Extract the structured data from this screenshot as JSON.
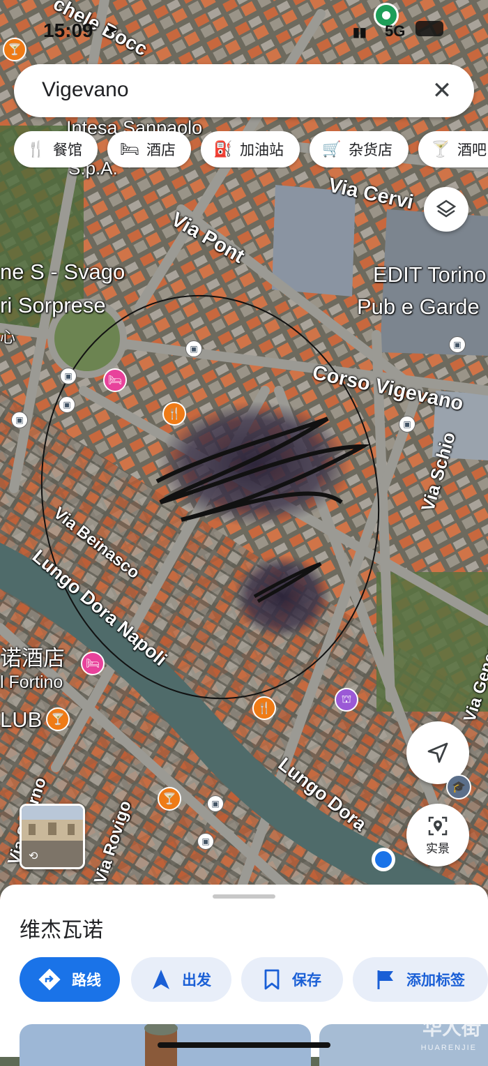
{
  "status_bar": {
    "time": "15:09",
    "network": "5G"
  },
  "search": {
    "query": "Vigevano",
    "clear_icon": "close-icon"
  },
  "chips": [
    {
      "label": "餐馆",
      "icon": "restaurant-icon"
    },
    {
      "label": "酒店",
      "icon": "hotel-icon"
    },
    {
      "label": "加油站",
      "icon": "gas-station-icon"
    },
    {
      "label": "杂货店",
      "icon": "grocery-cart-icon"
    },
    {
      "label": "酒吧",
      "icon": "bar-icon"
    }
  ],
  "map": {
    "labels": {
      "bocc": "chele Bocc",
      "intesa": "Intesa Sanpaolo",
      "spa": "S.p.A.",
      "via_cervino": "Via Cervi",
      "via_pont": "Via Pont",
      "svago": "ne S - Svago",
      "sorprese": "ri Sorprese",
      "edit": "EDIT Torino",
      "pub": "Pub e Garde",
      "corso_vigevano": "Corso Vigevano",
      "via_schio": "Via Schio",
      "via_beinasco": "Via Beinasco",
      "lungo_dora_napoli": "Lungo Dora Napoli",
      "hotel_cn": "诺酒店",
      "fortino": "l Fortino",
      "club": "LUB",
      "lungo_dora": "Lungo Dora",
      "via_rovigo": "Via Rovigo",
      "via_salerno": "Via Salerno",
      "via_generale": "Via General",
      "xin": "心"
    },
    "colors": {
      "poi_orange": "#ef7b16",
      "poi_pink": "#e8429b",
      "poi_purple": "#9b59d6",
      "river": "#4f6b6a",
      "my_location": "#1a73e8"
    }
  },
  "buttons": {
    "layers_icon": "layers-icon",
    "locate_icon": "navigation-arrow-icon",
    "live_view_label": "实景"
  },
  "sheet": {
    "place_name": "维杰瓦诺",
    "actions": [
      {
        "label": "路线",
        "icon": "directions-icon"
      },
      {
        "label": "出发",
        "icon": "navigation-icon"
      },
      {
        "label": "保存",
        "icon": "bookmark-icon"
      },
      {
        "label": "添加标签",
        "icon": "flag-icon"
      }
    ]
  },
  "watermark": {
    "text": "华人街",
    "sub": "HUARENJIE"
  }
}
